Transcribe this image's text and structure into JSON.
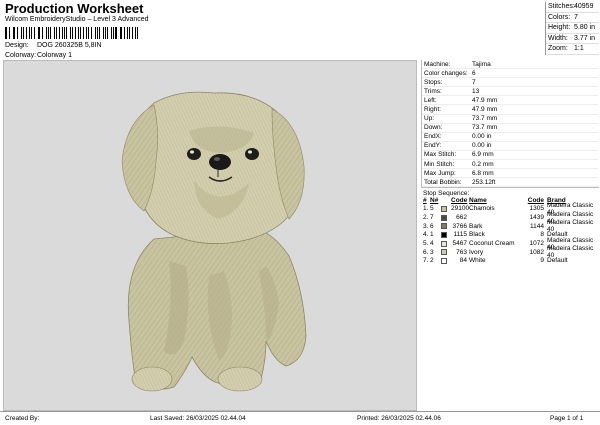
{
  "header": {
    "title": "Production Worksheet",
    "subtitle": "Wilcom EmbroideryStudio – Level 3 Advanced",
    "design_label": "Design:",
    "design_value": "DOG 260325B 5,8IN",
    "colorway_label": "Colorway:",
    "colorway_value": "Colorway 1"
  },
  "top_stats": [
    {
      "label": "Stitches:",
      "value": "40959"
    },
    {
      "label": "Colors:",
      "value": "7"
    },
    {
      "label": "Height:",
      "value": "5.80 in"
    },
    {
      "label": "Width:",
      "value": "3.77 in"
    },
    {
      "label": "Zoom:",
      "value": "1:1"
    }
  ],
  "info": [
    {
      "label": "Machine:",
      "value": "Tajima"
    },
    {
      "label": "Color changes:",
      "value": "6"
    },
    {
      "label": "Stops:",
      "value": "7"
    },
    {
      "label": "Trims:",
      "value": "13"
    },
    {
      "label": "Left:",
      "value": "47.9 mm"
    },
    {
      "label": "Right:",
      "value": "47.9 mm"
    },
    {
      "label": "Up:",
      "value": "73.7 mm"
    },
    {
      "label": "Down:",
      "value": "73.7 mm"
    },
    {
      "label": "EndX:",
      "value": "0.00 in"
    },
    {
      "label": "EndY:",
      "value": "0.00 in"
    },
    {
      "label": "Max Stitch:",
      "value": "6.9 mm"
    },
    {
      "label": "Min Stitch:",
      "value": "0.2 mm"
    },
    {
      "label": "Max Jump:",
      "value": "6.8 mm"
    },
    {
      "label": "Total Bobbin:",
      "value": "253.12ft"
    }
  ],
  "sequence": {
    "title": "Stop Sequence:",
    "headers": [
      "#",
      "N#",
      "Code",
      "Name",
      "Code",
      "Brand"
    ],
    "rows": [
      {
        "num": "1.",
        "n": "5",
        "color": "#c9c4a0",
        "code": "29100",
        "name": "Chamois",
        "code2": "1305",
        "brand": "Madeira Classic 40"
      },
      {
        "num": "2.",
        "n": "7",
        "color": "#4a4d44",
        "code": "662",
        "name": "",
        "code2": "1439",
        "brand": "Madeira Classic 40"
      },
      {
        "num": "3.",
        "n": "6",
        "color": "#8a7a62",
        "code": "3766",
        "name": "Bark",
        "code2": "1144",
        "brand": "Madeira Classic 40"
      },
      {
        "num": "4.",
        "n": "1",
        "color": "#000000",
        "code": "1115",
        "name": "Black",
        "code2": "8",
        "brand": "Default"
      },
      {
        "num": "5.",
        "n": "4",
        "color": "#ede6d2",
        "code": "5467",
        "name": "Coconut Cream",
        "code2": "1072",
        "brand": "Madeira Classic 40"
      },
      {
        "num": "6.",
        "n": "3",
        "color": "#cfc9a6",
        "code": "763",
        "name": "Ivory",
        "code2": "1082",
        "brand": "Madeira Classic 40"
      },
      {
        "num": "7.",
        "n": "2",
        "color": "#ffffff",
        "code": "84",
        "name": "White",
        "code2": "9",
        "brand": "Default"
      }
    ]
  },
  "footer": {
    "created_by": "Created By:",
    "last_saved": "Last Saved: 26/03/2025 02.44.04",
    "printed": "Printed: 26/03/2025 02.44.06",
    "page": "Page 1 of 1"
  },
  "colors": {
    "background": "#dadada",
    "dog_main": "#c9c4a0",
    "dog_shadow": "#8a7a62",
    "dog_dark": "#4a4d44"
  }
}
